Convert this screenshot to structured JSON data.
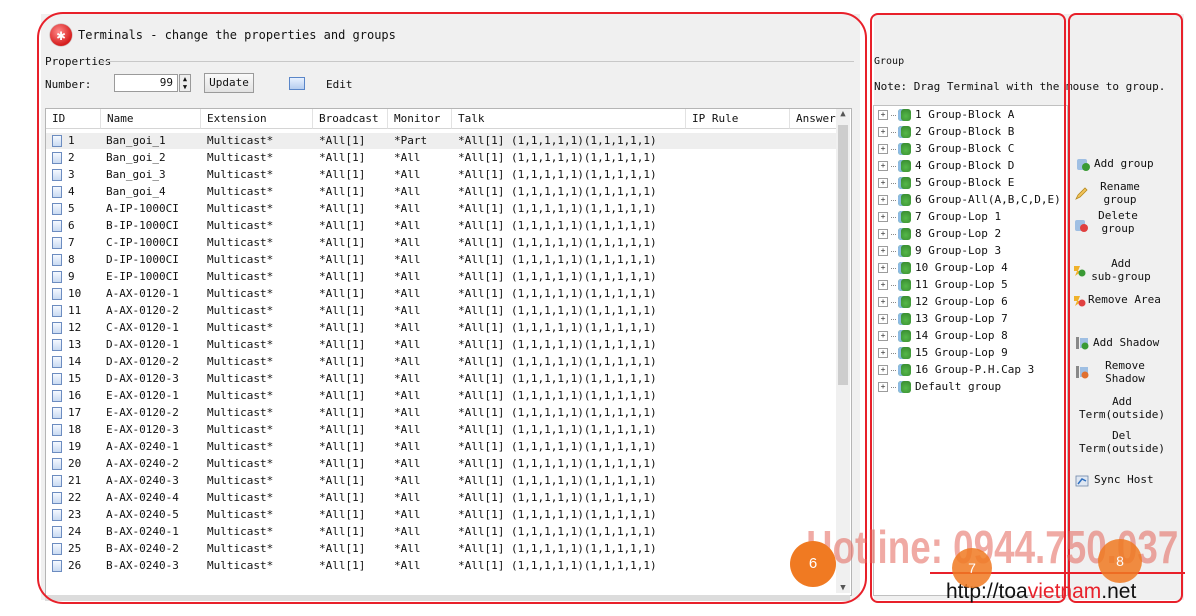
{
  "window": {
    "title": "Terminals - change the properties and groups",
    "icon": "close-icon"
  },
  "properties": {
    "section_label": "Properties",
    "number_label": "Number:",
    "number_value": "99",
    "update_label": "Update",
    "edit_label": "Edit"
  },
  "table": {
    "columns": [
      "ID",
      "Name",
      "Extension",
      "Broadcast",
      "Monitor",
      "Talk",
      "IP Rule",
      "Answer"
    ],
    "rows": [
      {
        "id": "1",
        "name": "Ban_goi_1",
        "ext": "Multicast*",
        "broadcast": "*All[1]",
        "monitor": "*Part",
        "talk": "*All[1] (1,1,1,1,1)(1,1,1,1,1)"
      },
      {
        "id": "2",
        "name": "Ban_goi_2",
        "ext": "Multicast*",
        "broadcast": "*All[1]",
        "monitor": "*All",
        "talk": "*All[1] (1,1,1,1,1)(1,1,1,1,1)"
      },
      {
        "id": "3",
        "name": "Ban_goi_3",
        "ext": "Multicast*",
        "broadcast": "*All[1]",
        "monitor": "*All",
        "talk": "*All[1] (1,1,1,1,1)(1,1,1,1,1)"
      },
      {
        "id": "4",
        "name": "Ban_goi_4",
        "ext": "Multicast*",
        "broadcast": "*All[1]",
        "monitor": "*All",
        "talk": "*All[1] (1,1,1,1,1)(1,1,1,1,1)"
      },
      {
        "id": "5",
        "name": "A-IP-1000CI",
        "ext": "Multicast*",
        "broadcast": "*All[1]",
        "monitor": "*All",
        "talk": "*All[1] (1,1,1,1,1)(1,1,1,1,1)"
      },
      {
        "id": "6",
        "name": "B-IP-1000CI",
        "ext": "Multicast*",
        "broadcast": "*All[1]",
        "monitor": "*All",
        "talk": "*All[1] (1,1,1,1,1)(1,1,1,1,1)"
      },
      {
        "id": "7",
        "name": "C-IP-1000CI",
        "ext": "Multicast*",
        "broadcast": "*All[1]",
        "monitor": "*All",
        "talk": "*All[1] (1,1,1,1,1)(1,1,1,1,1)"
      },
      {
        "id": "8",
        "name": "D-IP-1000CI",
        "ext": "Multicast*",
        "broadcast": "*All[1]",
        "monitor": "*All",
        "talk": "*All[1] (1,1,1,1,1)(1,1,1,1,1)"
      },
      {
        "id": "9",
        "name": "E-IP-1000CI",
        "ext": "Multicast*",
        "broadcast": "*All[1]",
        "monitor": "*All",
        "talk": "*All[1] (1,1,1,1,1)(1,1,1,1,1)"
      },
      {
        "id": "10",
        "name": "A-AX-0120-1",
        "ext": "Multicast*",
        "broadcast": "*All[1]",
        "monitor": "*All",
        "talk": "*All[1] (1,1,1,1,1)(1,1,1,1,1)"
      },
      {
        "id": "11",
        "name": "A-AX-0120-2",
        "ext": "Multicast*",
        "broadcast": "*All[1]",
        "monitor": "*All",
        "talk": "*All[1] (1,1,1,1,1)(1,1,1,1,1)"
      },
      {
        "id": "12",
        "name": "C-AX-0120-1",
        "ext": "Multicast*",
        "broadcast": "*All[1]",
        "monitor": "*All",
        "talk": "*All[1] (1,1,1,1,1)(1,1,1,1,1)"
      },
      {
        "id": "13",
        "name": "D-AX-0120-1",
        "ext": "Multicast*",
        "broadcast": "*All[1]",
        "monitor": "*All",
        "talk": "*All[1] (1,1,1,1,1)(1,1,1,1,1)"
      },
      {
        "id": "14",
        "name": "D-AX-0120-2",
        "ext": "Multicast*",
        "broadcast": "*All[1]",
        "monitor": "*All",
        "talk": "*All[1] (1,1,1,1,1)(1,1,1,1,1)"
      },
      {
        "id": "15",
        "name": "D-AX-0120-3",
        "ext": "Multicast*",
        "broadcast": "*All[1]",
        "monitor": "*All",
        "talk": "*All[1] (1,1,1,1,1)(1,1,1,1,1)"
      },
      {
        "id": "16",
        "name": "E-AX-0120-1",
        "ext": "Multicast*",
        "broadcast": "*All[1]",
        "monitor": "*All",
        "talk": "*All[1] (1,1,1,1,1)(1,1,1,1,1)"
      },
      {
        "id": "17",
        "name": "E-AX-0120-2",
        "ext": "Multicast*",
        "broadcast": "*All[1]",
        "monitor": "*All",
        "talk": "*All[1] (1,1,1,1,1)(1,1,1,1,1)"
      },
      {
        "id": "18",
        "name": "E-AX-0120-3",
        "ext": "Multicast*",
        "broadcast": "*All[1]",
        "monitor": "*All",
        "talk": "*All[1] (1,1,1,1,1)(1,1,1,1,1)"
      },
      {
        "id": "19",
        "name": "A-AX-0240-1",
        "ext": "Multicast*",
        "broadcast": "*All[1]",
        "monitor": "*All",
        "talk": "*All[1] (1,1,1,1,1)(1,1,1,1,1)"
      },
      {
        "id": "20",
        "name": "A-AX-0240-2",
        "ext": "Multicast*",
        "broadcast": "*All[1]",
        "monitor": "*All",
        "talk": "*All[1] (1,1,1,1,1)(1,1,1,1,1)"
      },
      {
        "id": "21",
        "name": "A-AX-0240-3",
        "ext": "Multicast*",
        "broadcast": "*All[1]",
        "monitor": "*All",
        "talk": "*All[1] (1,1,1,1,1)(1,1,1,1,1)"
      },
      {
        "id": "22",
        "name": "A-AX-0240-4",
        "ext": "Multicast*",
        "broadcast": "*All[1]",
        "monitor": "*All",
        "talk": "*All[1] (1,1,1,1,1)(1,1,1,1,1)"
      },
      {
        "id": "23",
        "name": "A-AX-0240-5",
        "ext": "Multicast*",
        "broadcast": "*All[1]",
        "monitor": "*All",
        "talk": "*All[1] (1,1,1,1,1)(1,1,1,1,1)"
      },
      {
        "id": "24",
        "name": "B-AX-0240-1",
        "ext": "Multicast*",
        "broadcast": "*All[1]",
        "monitor": "*All",
        "talk": "*All[1] (1,1,1,1,1)(1,1,1,1,1)"
      },
      {
        "id": "25",
        "name": "B-AX-0240-2",
        "ext": "Multicast*",
        "broadcast": "*All[1]",
        "monitor": "*All",
        "talk": "*All[1] (1,1,1,1,1)(1,1,1,1,1)"
      },
      {
        "id": "26",
        "name": "B-AX-0240-3",
        "ext": "Multicast*",
        "broadcast": "*All[1]",
        "monitor": "*All",
        "talk": "*All[1] (1,1,1,1,1)(1,1,1,1,1)"
      }
    ]
  },
  "group": {
    "label": "Group",
    "note": "Note: Drag Terminal with the mouse to group.",
    "items": [
      "1 Group-Block A",
      "2 Group-Block B",
      "3 Group-Block C",
      "4 Group-Block D",
      "5 Group-Block E",
      "6 Group-All(A,B,C,D,E)",
      "7 Group-Lop 1",
      "8 Group-Lop 2",
      "9 Group-Lop 3",
      "10 Group-Lop 4",
      "11 Group-Lop 5",
      "12 Group-Lop 6",
      "13 Group-Lop 7",
      "14 Group-Lop 8",
      "15 Group-Lop 9",
      "16 Group-P.H.Cap 3",
      "Default group"
    ]
  },
  "actions": {
    "add_group": "Add group",
    "rename_group": [
      "Rename",
      "group"
    ],
    "delete_group": [
      "Delete",
      "group"
    ],
    "add_subgroup": [
      "Add",
      "sub-group"
    ],
    "remove_area": "Remove Area",
    "add_shadow": "Add Shadow",
    "remove_shadow": [
      "Remove",
      "Shadow"
    ],
    "add_term_outside": [
      "Add",
      "Term(outside)"
    ],
    "del_term_outside": [
      "Del",
      "Term(outside)"
    ],
    "sync_host": "Sync Host"
  },
  "annotations": {
    "badge_6": "6",
    "badge_7": "7",
    "badge_8": "8",
    "hotline": "Hotline: 0944.750.037",
    "website_prefix": "http://toa",
    "website_red": "vietnam",
    "website_suffix": ".net",
    "box_color": "#e8202a",
    "badge_color": "#f07a22"
  }
}
